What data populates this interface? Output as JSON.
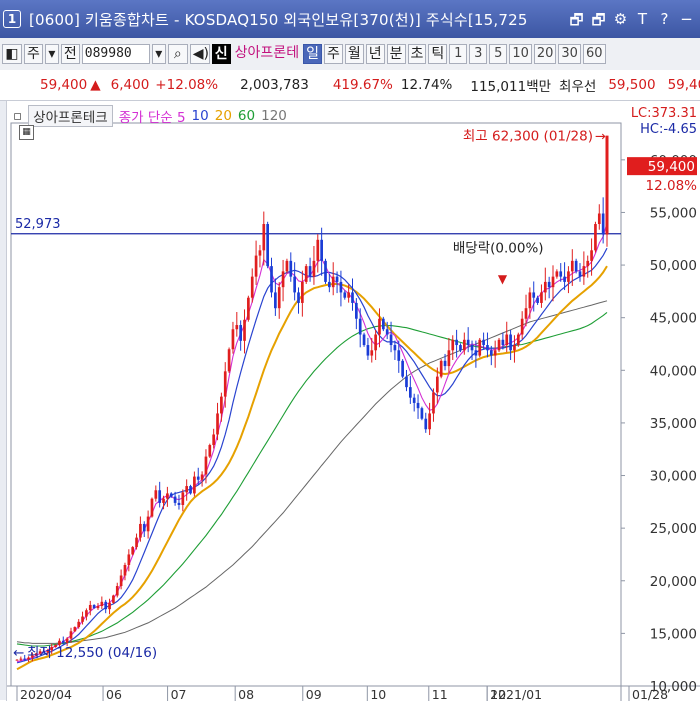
{
  "window": {
    "index": "1",
    "title": "[0600] 키움종합차트 - KOSDAQ150 외국인보유[370(천)] 주식수[15,725",
    "buttons": [
      "🗗",
      "🗗",
      "⚙",
      "T",
      "?",
      "−"
    ]
  },
  "toolbar": {
    "items": [
      "주",
      "전"
    ],
    "code": "089980",
    "search_icon": "search-icon",
    "sound_icon": "speaker-icon",
    "new_label": "신",
    "stock_name": "상아프론테",
    "periods": [
      "일",
      "주",
      "월",
      "년",
      "분",
      "초",
      "틱"
    ],
    "selected_period": "일",
    "numbers": [
      "1",
      "3",
      "5",
      "10",
      "20",
      "30",
      "60"
    ]
  },
  "quote": {
    "price": "59,400",
    "change": "6,400",
    "change_pct": "+12.08%",
    "volume": "2,003,783",
    "volume_ratio": "419.67%",
    "turnover": "12.74%",
    "amount": "115,011백만",
    "best_label": "최우선",
    "best_ask": "59,500",
    "best_bid": "59,40"
  },
  "legend": {
    "name": "상아프론테크",
    "ma_label": "종가 단순 5",
    "ma10": "10",
    "ma20": "20",
    "ma60": "60",
    "ma120": "120",
    "colors": {
      "ma5": "#d42fd4",
      "ma10": "#2a44d0",
      "ma20": "#e6a100",
      "ma60": "#1e9e35",
      "ma120": "#666666"
    }
  },
  "chart_data": {
    "type": "candlestick",
    "ylim": [
      10000,
      63500
    ],
    "y_ticks": [
      "10,000",
      "15,000",
      "20,000",
      "25,000",
      "30,000",
      "35,000",
      "40,000",
      "45,000",
      "50,000",
      "55,000",
      "60,000"
    ],
    "x_ticks": [
      "2020/04",
      "06",
      "07",
      "08",
      "09",
      "10",
      "11",
      "12",
      "2021/01",
      "01/28"
    ],
    "lc": "LC:373.31",
    "hc": "HC:-4.65",
    "last_price": "59,400",
    "last_pct": "12.08%",
    "hline_value": 52973,
    "hline_label": "52,973",
    "max_label": "최고 62,300 (01/28)",
    "max_value": 62300,
    "min_label": "최저 12,550 (04/16)",
    "min_value": 12550,
    "dividend_label": "배당락(0.00%)",
    "closes": [
      12500,
      12600,
      12550,
      12700,
      12900,
      13100,
      13300,
      13200,
      13400,
      13700,
      13900,
      14300,
      14100,
      14500,
      15200,
      15600,
      16100,
      16600,
      17200,
      17700,
      17400,
      17600,
      18000,
      17300,
      17900,
      18600,
      19500,
      20500,
      21500,
      22500,
      23200,
      24100,
      25400,
      24700,
      26100,
      27800,
      28600,
      27400,
      27800,
      28300,
      28000,
      27400,
      27200,
      28400,
      29000,
      28300,
      29900,
      29600,
      30100,
      31800,
      32900,
      33900,
      35900,
      37500,
      39900,
      42000,
      43900,
      44300,
      42800,
      44800,
      46900,
      48900,
      50900,
      51400,
      53900,
      49900,
      47400,
      45900,
      47900,
      49400,
      50400,
      48900,
      47400,
      46400,
      48400,
      49900,
      48900,
      50400,
      52400,
      50400,
      48400,
      47900,
      48900,
      48400,
      47400,
      46900,
      47400,
      46400,
      44900,
      43400,
      42400,
      41400,
      41900,
      43400,
      44900,
      43900,
      43400,
      42400,
      41900,
      40900,
      39400,
      38400,
      37400,
      36900,
      36400,
      35400,
      34400,
      35900,
      37900,
      39400,
      40900,
      40400,
      41900,
      42900,
      42400,
      41900,
      42900,
      42400,
      41900,
      41400,
      42900,
      42400,
      41900,
      41400,
      41900,
      42900,
      42400,
      43400,
      41900,
      42400,
      43400,
      44900,
      45900,
      47400,
      46900,
      46400,
      47400,
      48400,
      47900,
      48900,
      49400,
      48900,
      48400,
      49400,
      50400,
      49400,
      48900,
      49900,
      50400,
      51400,
      53900,
      54900,
      52900,
      59400
    ],
    "ma5": [
      12300,
      12400,
      12500,
      12600,
      12700,
      12900,
      13100,
      13250,
      13400,
      13600,
      13800,
      14000,
      14200,
      14500,
      14800,
      15200,
      15700,
      16200,
      16700,
      17100,
      17400,
      17600,
      17700,
      17800,
      17900,
      18300,
      18900,
      19700,
      20600,
      21500,
      22400,
      23300,
      24200,
      24900,
      25600,
      26400,
      27300,
      27600,
      27900,
      28100,
      28000,
      27800,
      27700,
      27900,
      28200,
      28500,
      29000,
      29300,
      29600,
      30300,
      31300,
      32400,
      33900,
      35400,
      37300,
      39400,
      41300,
      42600,
      43500,
      44300,
      45400,
      46500,
      47800,
      49000,
      50500,
      50100,
      49200,
      48300,
      48100,
      48600,
      49200,
      49300,
      49000,
      48500,
      48400,
      48700,
      49000,
      49600,
      50300,
      50600,
      49900,
      49100,
      48600,
      48300,
      48000,
      47600,
      47300,
      46800,
      46200,
      45400,
      44500,
      43500,
      42800,
      42400,
      42600,
      43000,
      43500,
      43600,
      43300,
      42500,
      41700,
      40800,
      39900,
      39100,
      38300,
      37400,
      36700,
      36200,
      36300,
      36800,
      37700,
      38700,
      39700,
      40400,
      41000,
      41500,
      41900,
      42300,
      42500,
      42400,
      42300,
      42200,
      42100,
      41900,
      42000,
      42100,
      42300,
      42500,
      42600,
      42800,
      43100,
      43700,
      44400,
      45400,
      46300,
      46900,
      47300,
      47700,
      47800,
      48100,
      48400,
      48600,
      48700,
      48900,
      49200,
      49400,
      49500,
      49700,
      49900,
      50300,
      51100,
      52100,
      52700,
      54000
    ],
    "ma10": [
      12200,
      12300,
      12400,
      12500,
      12600,
      12700,
      12850,
      13000,
      13150,
      13300,
      13500,
      13700,
      13900,
      14100,
      14350,
      14600,
      14900,
      15300,
      15700,
      16100,
      16500,
      16900,
      17200,
      17450,
      17650,
      17800,
      18050,
      18400,
      18900,
      19450,
      20100,
      20900,
      21800,
      22700,
      23600,
      24500,
      25400,
      26300,
      27100,
      27700,
      28100,
      28300,
      28400,
      28500,
      28600,
      28700,
      28900,
      29100,
      29400,
      29800,
      30300,
      30900,
      31700,
      32700,
      33900,
      35300,
      36900,
      38400,
      39800,
      41100,
      42400,
      43600,
      44800,
      45900,
      47000,
      47800,
      48300,
      48600,
      48900,
      49100,
      49300,
      49400,
      49500,
      49400,
      49200,
      49000,
      48900,
      48900,
      49000,
      49200,
      49300,
      49300,
      49200,
      49100,
      48900,
      48600,
      48200,
      47800,
      47300,
      46700,
      46000,
      45200,
      44500,
      43800,
      43300,
      42900,
      42700,
      42700,
      42700,
      42500,
      42200,
      41800,
      41300,
      40800,
      40200,
      39600,
      39000,
      38400,
      37900,
      37600,
      37600,
      37800,
      38200,
      38700,
      39300,
      39900,
      40500,
      41000,
      41400,
      41700,
      41900,
      42000,
      42100,
      42100,
      42100,
      42100,
      42100,
      42200,
      42300,
      42400,
      42600,
      42900,
      43300,
      43800,
      44300,
      44800,
      45300,
      45800,
      46300,
      46800,
      47200,
      47600,
      47900,
      48200,
      48500,
      48700,
      48900,
      49100,
      49300,
      49500,
      49900,
      50400,
      50900,
      51600
    ],
    "ma20": [
      11600,
      11800,
      12000,
      12200,
      12400,
      12500,
      12600,
      12700,
      12800,
      12950,
      13100,
      13250,
      13400,
      13550,
      13700,
      13900,
      14100,
      14350,
      14600,
      14900,
      15200,
      15550,
      15900,
      16250,
      16600,
      16950,
      17250,
      17550,
      17800,
      18100,
      18450,
      18850,
      19300,
      19800,
      20350,
      20950,
      21600,
      22300,
      23000,
      23700,
      24400,
      25100,
      25800,
      26400,
      27000,
      27500,
      27900,
      28200,
      28500,
      28750,
      29000,
      29300,
      29650,
      30100,
      30600,
      31200,
      31900,
      32700,
      33600,
      34600,
      35600,
      36700,
      37800,
      38900,
      40000,
      41000,
      41900,
      42700,
      43500,
      44200,
      44900,
      45600,
      46200,
      46700,
      47100,
      47400,
      47600,
      47800,
      47900,
      48000,
      48100,
      48150,
      48200,
      48200,
      48150,
      48050,
      47900,
      47700,
      47450,
      47150,
      46800,
      46400,
      46000,
      45550,
      45100,
      44650,
      44200,
      43800,
      43400,
      43050,
      42700,
      42350,
      42000,
      41650,
      41300,
      40950,
      40600,
      40300,
      40050,
      39850,
      39700,
      39650,
      39700,
      39800,
      39950,
      40150,
      40350,
      40550,
      40750,
      40950,
      41100,
      41250,
      41350,
      41450,
      41500,
      41550,
      41600,
      41650,
      41700,
      41800,
      41900,
      42050,
      42250,
      42500,
      42800,
      43150,
      43550,
      43950,
      44350,
      44750,
      45150,
      45550,
      45900,
      46250,
      46600,
      46900,
      47200,
      47500,
      47800,
      48100,
      48450,
      48850,
      49300,
      49900
    ],
    "ma60": [
      14000,
      13950,
      13900,
      13850,
      13800,
      13800,
      13800,
      13800,
      13850,
      13900,
      13950,
      14000,
      14050,
      14100,
      14200,
      14300,
      14400,
      14500,
      14600,
      14750,
      14900,
      15050,
      15200,
      15400,
      15600,
      15800,
      16000,
      16250,
      16500,
      16750,
      17000,
      17300,
      17600,
      17900,
      18200,
      18550,
      18900,
      19250,
      19600,
      20000,
      20400,
      20800,
      21200,
      21600,
      22050,
      22500,
      22950,
      23400,
      23850,
      24300,
      24800,
      25300,
      25800,
      26300,
      26850,
      27400,
      27950,
      28500,
      29100,
      29700,
      30300,
      30900,
      31500,
      32100,
      32700,
      33300,
      33900,
      34500,
      35100,
      35700,
      36300,
      36900,
      37450,
      38000,
      38500,
      39000,
      39450,
      39900,
      40300,
      40700,
      41100,
      41450,
      41800,
      42150,
      42450,
      42750,
      43000,
      43250,
      43450,
      43650,
      43800,
      43950,
      44050,
      44150,
      44200,
      44250,
      44250,
      44250,
      44200,
      44150,
      44100,
      44050,
      43950,
      43850,
      43750,
      43650,
      43550,
      43450,
      43350,
      43250,
      43150,
      43050,
      42950,
      42850,
      42750,
      42650,
      42550,
      42450,
      42350,
      42250,
      42200,
      42150,
      42100,
      42100,
      42100,
      42150,
      42200,
      42250,
      42300,
      42350,
      42400,
      42450,
      42550,
      42650,
      42750,
      42850,
      42950,
      43050,
      43150,
      43250,
      43350,
      43450,
      43550,
      43650,
      43750,
      43850,
      43950,
      44100,
      44250,
      44450,
      44700,
      44950,
      45200,
      45500
    ],
    "ma120": [
      14200,
      14150,
      14100,
      14100,
      14050,
      14050,
      14050,
      14050,
      14050,
      14050,
      14050,
      14100,
      14100,
      14150,
      14150,
      14200,
      14250,
      14300,
      14350,
      14400,
      14450,
      14500,
      14550,
      14600,
      14700,
      14800,
      14900,
      15000,
      15100,
      15250,
      15400,
      15550,
      15700,
      15850,
      16000,
      16200,
      16400,
      16600,
      16800,
      17000,
      17200,
      17400,
      17650,
      17900,
      18150,
      18400,
      18650,
      18900,
      19150,
      19400,
      19700,
      20000,
      20300,
      20600,
      20900,
      21200,
      21500,
      21850,
      22200,
      22550,
      22900,
      23250,
      23650,
      24050,
      24450,
      24850,
      25250,
      25650,
      26050,
      26450,
      26900,
      27350,
      27800,
      28250,
      28700,
      29150,
      29600,
      30050,
      30500,
      30950,
      31400,
      31850,
      32300,
      32750,
      33200,
      33600,
      34000,
      34400,
      34800,
      35200,
      35600,
      36000,
      36400,
      36800,
      37150,
      37500,
      37850,
      38200,
      38500,
      38800,
      39100,
      39400,
      39650,
      39900,
      40100,
      40300,
      40500,
      40700,
      40850,
      41000,
      41150,
      41300,
      41450,
      41600,
      41750,
      41900,
      42050,
      42200,
      42350,
      42500,
      42650,
      42800,
      42950,
      43100,
      43250,
      43400,
      43550,
      43700,
      43850,
      44000,
      44150,
      44300,
      44450,
      44600,
      44700,
      44800,
      44900,
      45000,
      45100,
      45200,
      45300,
      45400,
      45500,
      45600,
      45700,
      45800,
      45900,
      46000,
      46100,
      46200,
      46300,
      46400,
      46500,
      46600
    ]
  }
}
